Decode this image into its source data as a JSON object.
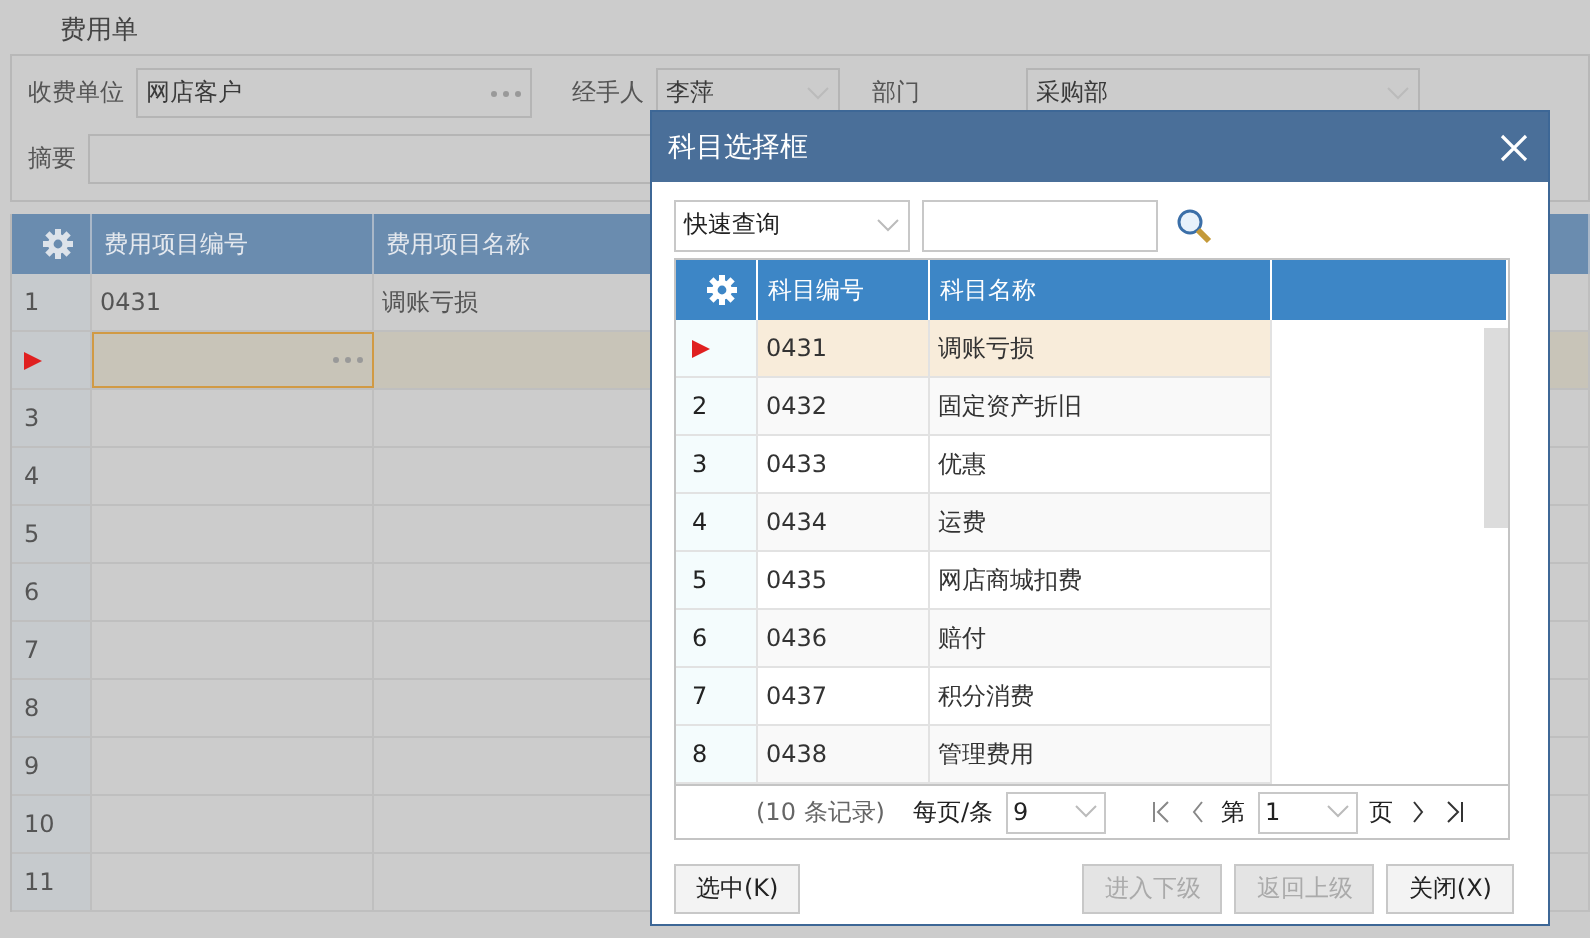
{
  "page": {
    "title": "费用单",
    "form": {
      "fields": [
        {
          "label": "收费单位",
          "value": "网店客户",
          "kind": "lookup"
        },
        {
          "label": "经手人",
          "value": "李萍",
          "kind": "select"
        },
        {
          "label": "部门",
          "value": "采购部",
          "kind": "select"
        }
      ],
      "summary": {
        "label": "摘要"
      }
    },
    "grid": {
      "columns": [
        "费用项目编号",
        "费用项目名称"
      ],
      "rows": [
        {
          "number": "1",
          "selected": false,
          "cells": [
            "0431",
            "调账亏损"
          ]
        },
        {
          "selected": true
        },
        {
          "number": "3",
          "selected": false
        },
        {
          "number": "4",
          "selected": false
        },
        {
          "number": "5",
          "selected": false
        },
        {
          "number": "6",
          "selected": false
        },
        {
          "number": "7",
          "selected": false
        },
        {
          "number": "8",
          "selected": false
        },
        {
          "number": "9",
          "selected": false
        },
        {
          "number": "10",
          "selected": false
        },
        {
          "number": "11",
          "selected": false
        }
      ]
    }
  },
  "dialog": {
    "title": "科目选择框",
    "filter": {
      "value": "快速查询"
    },
    "columns": [
      "科目编号",
      "科目名称"
    ],
    "rows": [
      {
        "selected": true,
        "code": "0431",
        "name": "调账亏损"
      },
      {
        "number": "2",
        "selected": false,
        "code": "0432",
        "name": "固定资产折旧"
      },
      {
        "number": "3",
        "selected": false,
        "code": "0433",
        "name": "优惠"
      },
      {
        "number": "4",
        "selected": false,
        "code": "0434",
        "name": "运费"
      },
      {
        "number": "5",
        "selected": false,
        "code": "0435",
        "name": "网店商城扣费"
      },
      {
        "number": "6",
        "selected": false,
        "code": "0436",
        "name": "赔付"
      },
      {
        "number": "7",
        "selected": false,
        "code": "0437",
        "name": "积分消费"
      },
      {
        "number": "8",
        "selected": false,
        "code": "0438",
        "name": "管理费用"
      }
    ],
    "pager": {
      "records": "(10 条记录)",
      "per_page_label": "每页/条",
      "per_page": "9",
      "page_prefix": "第",
      "page": "1",
      "page_suffix": "页"
    },
    "buttons": [
      {
        "label": "选中(K)",
        "disabled": false
      },
      {
        "label": "进入下级",
        "disabled": true
      },
      {
        "label": "返回上级",
        "disabled": true
      },
      {
        "label": "关闭(X)",
        "disabled": false
      }
    ]
  }
}
